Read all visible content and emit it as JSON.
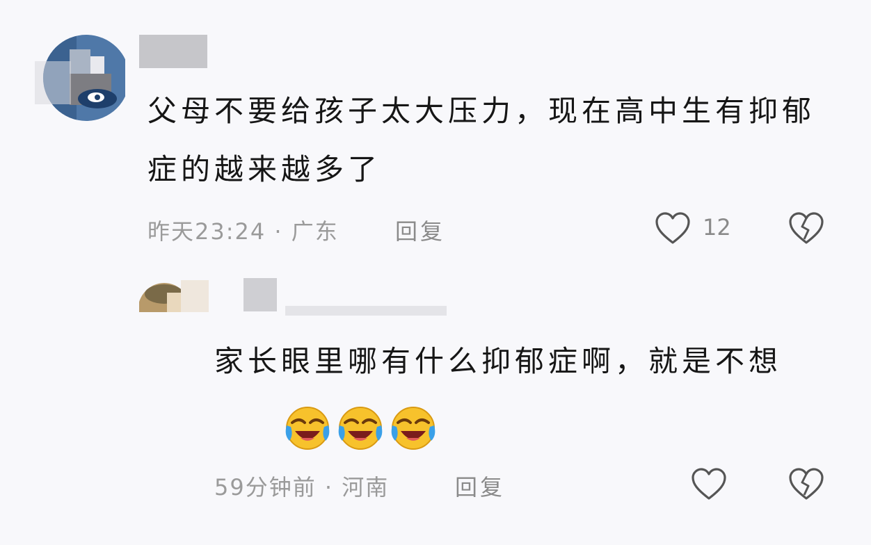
{
  "comments": [
    {
      "text": "父母不要给孩子太大压力，现在高中生有抑郁症的越来越多了",
      "time_location": "昨天23:24 · 广东",
      "reply_label": "回复",
      "like_count": "12",
      "like_icon": "heart-outline-icon",
      "dislike_icon": "broken-heart-icon"
    },
    {
      "text": "家长眼里哪有什么抑郁症啊，就是不想",
      "emojis": [
        "laugh-cry-emoji",
        "laugh-cry-emoji",
        "laugh-cry-emoji"
      ],
      "time_location": "59分钟前 · 河南",
      "reply_label": "回复",
      "like_icon": "heart-outline-icon",
      "dislike_icon": "broken-heart-icon"
    }
  ],
  "colors": {
    "background": "#f8f8fb",
    "text": "#161616",
    "meta": "#9a9a9a",
    "icon": "#555555",
    "emoji_yellow": "#f7c22c",
    "emoji_tears": "#3aa0e8"
  }
}
